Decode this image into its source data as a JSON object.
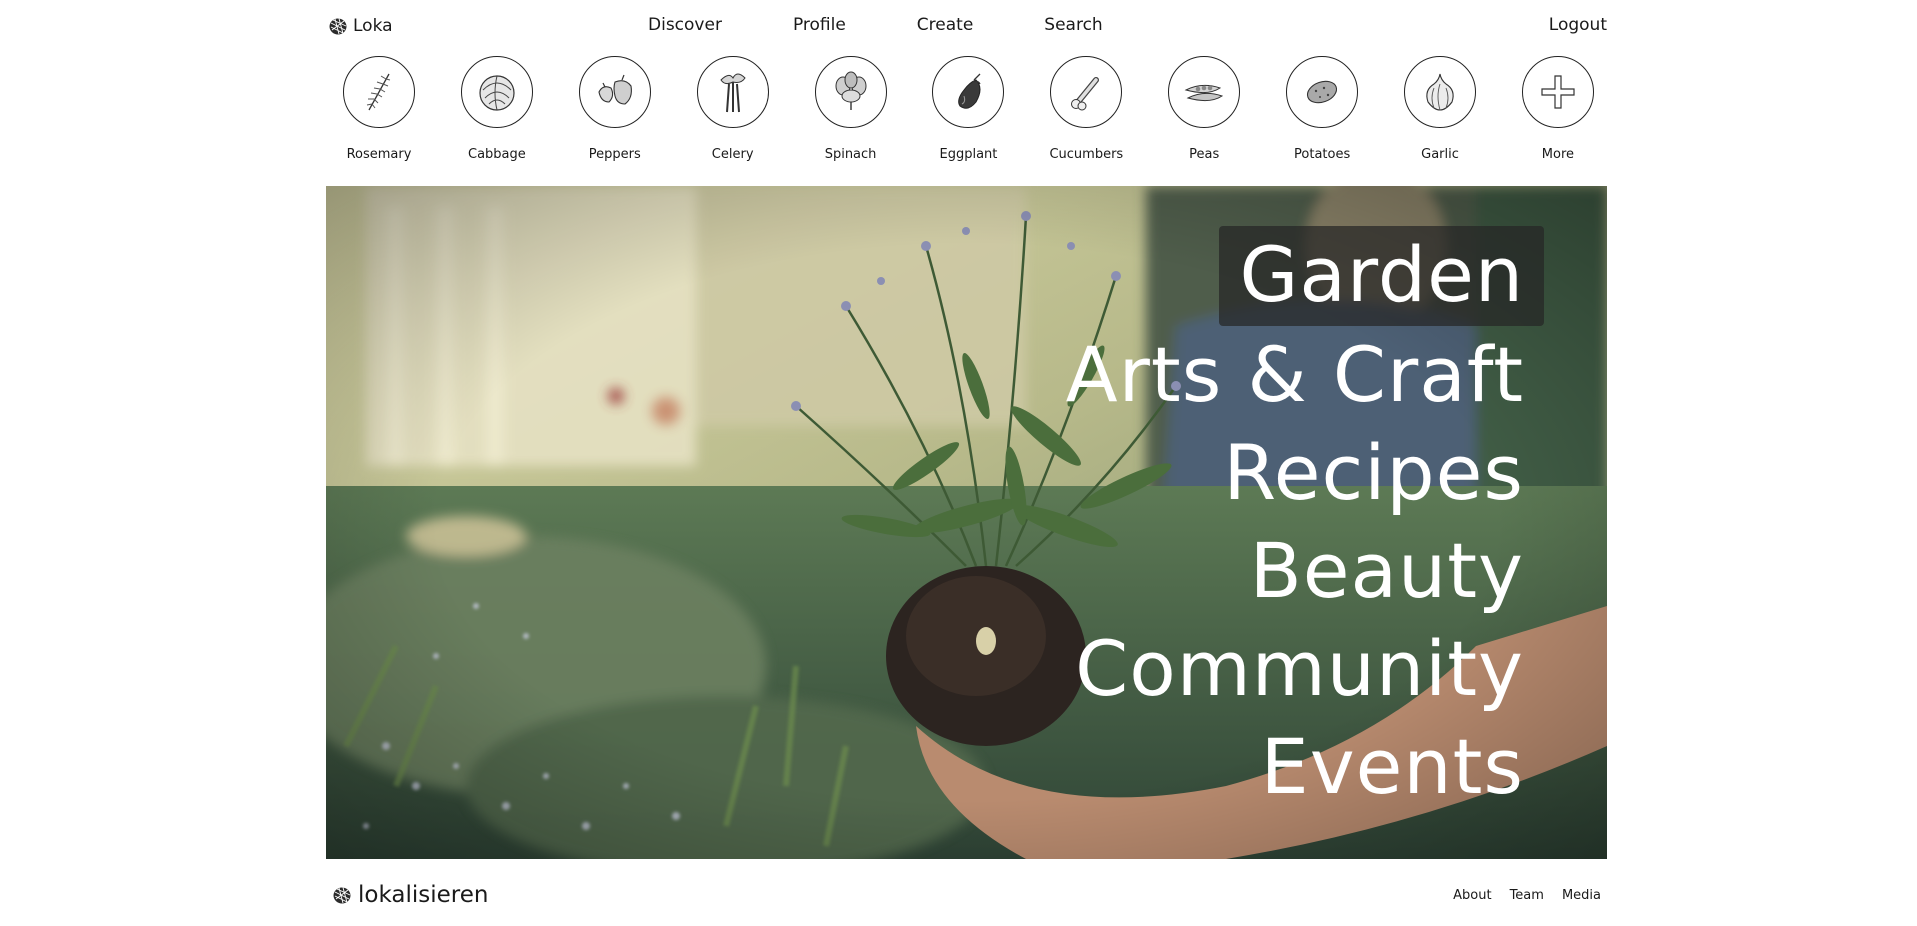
{
  "nav": {
    "brand": "Loka",
    "links": [
      "Discover",
      "Profile",
      "Create",
      "Search"
    ],
    "logout": "Logout"
  },
  "categories": [
    {
      "label": "Rosemary",
      "icon": "rosemary-icon"
    },
    {
      "label": "Cabbage",
      "icon": "cabbage-icon"
    },
    {
      "label": "Peppers",
      "icon": "peppers-icon"
    },
    {
      "label": "Celery",
      "icon": "celery-icon"
    },
    {
      "label": "Spinach",
      "icon": "spinach-icon"
    },
    {
      "label": "Eggplant",
      "icon": "eggplant-icon"
    },
    {
      "label": "Cucumbers",
      "icon": "cucumbers-icon"
    },
    {
      "label": "Peas",
      "icon": "peas-icon"
    },
    {
      "label": "Potatoes",
      "icon": "potatoes-icon"
    },
    {
      "label": "Garlic",
      "icon": "garlic-icon"
    },
    {
      "label": "More",
      "icon": "plus-icon"
    }
  ],
  "hero": {
    "image": "garden-photo",
    "items": [
      "Garden",
      "Arts & Craft",
      "Recipes",
      "Beauty",
      "Community",
      "Events"
    ],
    "active_index": 0
  },
  "footer": {
    "brand": "lokalisieren",
    "links": [
      "About",
      "Team",
      "Media"
    ]
  }
}
